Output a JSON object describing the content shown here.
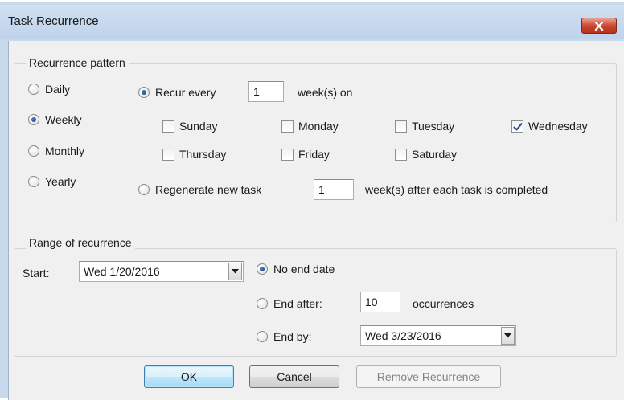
{
  "window": {
    "title": "Task Recurrence"
  },
  "pattern": {
    "legend": "Recurrence pattern",
    "frequencies": [
      {
        "label": "Daily",
        "checked": false
      },
      {
        "label": "Weekly",
        "checked": true
      },
      {
        "label": "Monthly",
        "checked": false
      },
      {
        "label": "Yearly",
        "checked": false
      }
    ],
    "recur_every_label": "Recur every",
    "recur_every_value": "1",
    "recur_every_suffix": "week(s) on",
    "days": [
      {
        "label": "Sunday",
        "checked": false
      },
      {
        "label": "Monday",
        "checked": false
      },
      {
        "label": "Tuesday",
        "checked": false
      },
      {
        "label": "Wednesday",
        "checked": true
      },
      {
        "label": "Thursday",
        "checked": false
      },
      {
        "label": "Friday",
        "checked": false
      },
      {
        "label": "Saturday",
        "checked": false
      }
    ],
    "regenerate_label": "Regenerate new task",
    "regenerate_value": "1",
    "regenerate_suffix": "week(s) after each task is completed"
  },
  "range": {
    "legend": "Range of recurrence",
    "start_label": "Start:",
    "start_value": "Wed 1/20/2016",
    "no_end_label": "No end date",
    "end_after_label": "End after:",
    "end_after_value": "10",
    "occurrences_label": "occurrences",
    "end_by_label": "End by:",
    "end_by_value": "Wed 3/23/2016"
  },
  "buttons": {
    "ok": "OK",
    "cancel": "Cancel",
    "remove": "Remove Recurrence"
  },
  "colors": {
    "title_bar": "#c8d9ec",
    "close_button": "#c7412b",
    "dialog_bg": "#f0f0f0",
    "default_button_border": "#3c7fb1"
  },
  "icons": {
    "close": "close-icon",
    "dropdown": "chevron-down-icon"
  }
}
